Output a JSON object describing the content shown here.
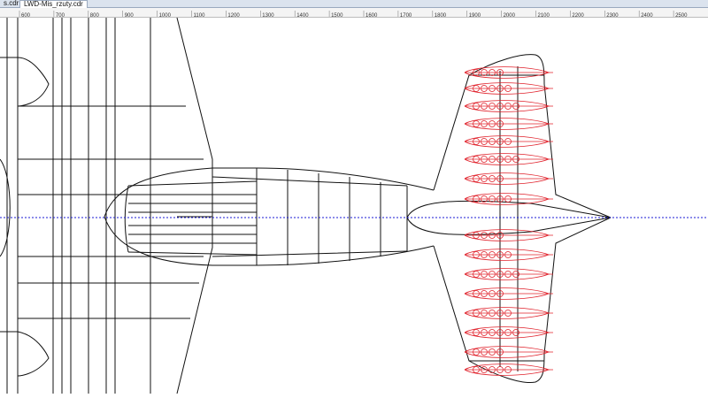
{
  "tabs": [
    {
      "label": "s.cdr",
      "active": false
    },
    {
      "label": "LWD-Mis_rzuty.cdr",
      "active": true
    }
  ],
  "ruler": {
    "labels": [
      "600",
      "700",
      "800",
      "900",
      "1000",
      "1100",
      "1200",
      "1300",
      "1400",
      "1500",
      "1600",
      "1700",
      "1800",
      "1900",
      "2000",
      "2100",
      "2200",
      "2300",
      "2400",
      "2500"
    ]
  },
  "colors": {
    "line": "#111111",
    "red_detail": "#e0202a",
    "centerline": "#1a1ad6",
    "ruler_bg": "#f4f4f4"
  }
}
